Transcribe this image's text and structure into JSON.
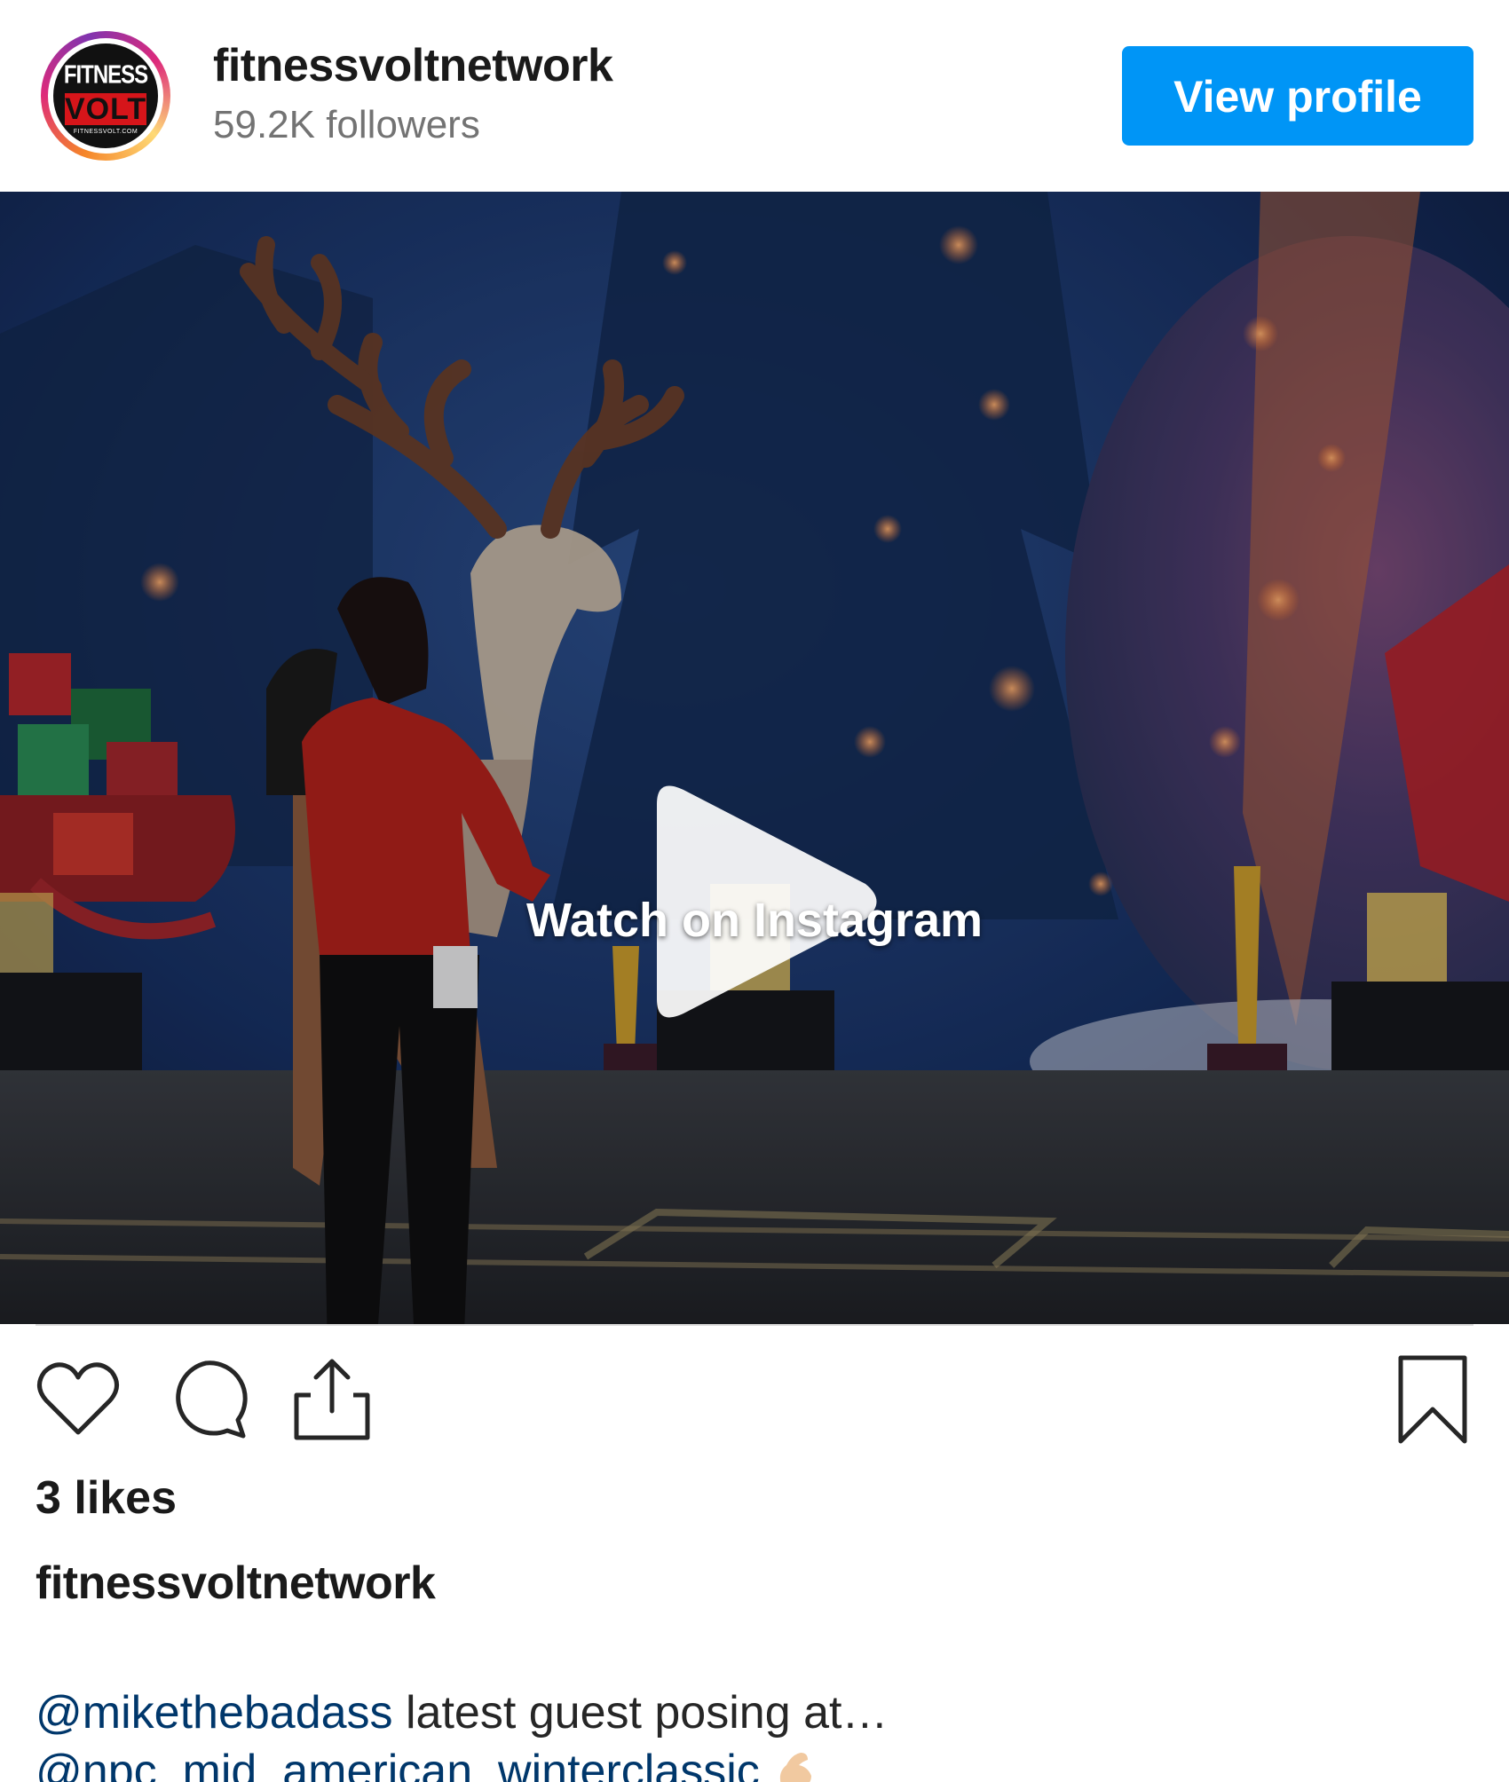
{
  "header": {
    "avatar_logo_top": "FITNESS",
    "avatar_logo_mid": "VOLT",
    "avatar_logo_bottom": "FITNESSVOLT.COM",
    "username": "fitnessvoltnetwork",
    "followers": "59.2K followers",
    "view_profile_label": "View profile"
  },
  "media": {
    "watch_label": "Watch on Instagram",
    "play_icon": "play-icon"
  },
  "actions": {
    "like_icon": "heart-icon",
    "comment_icon": "comment-icon",
    "share_icon": "share-icon",
    "save_icon": "bookmark-icon"
  },
  "post": {
    "likes": "3 likes",
    "caption_user": "fitnessvoltnetwork",
    "mention_1": "@mikethebadass",
    "caption_text_1": " latest guest posing at…",
    "mention_2": "@npc_mid_american_winterclassic",
    "emoji": "flexed-biceps"
  },
  "colors": {
    "accent": "#0095f6",
    "mention": "#00376b",
    "text": "#262626",
    "secondary": "#737373"
  }
}
